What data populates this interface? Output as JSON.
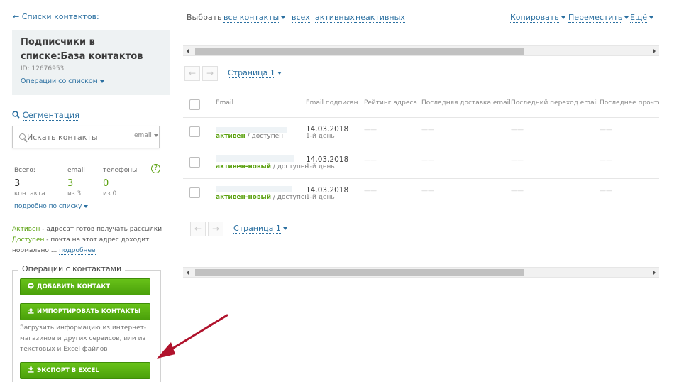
{
  "sidebar": {
    "back_link": "← Списки контактов:",
    "list_title": "Подписчики в списке:База контактов",
    "list_id": "ID: 12676953",
    "list_ops": "Операции со списком",
    "segmentation": "Сегментация",
    "search_placeholder": "Искать контакты",
    "search_type": "email",
    "stats": {
      "total_label": "Всего:",
      "email_label": "email",
      "phone_label": "телефоны",
      "total_value": "3",
      "email_value": "3",
      "phone_value": "0",
      "total_sub": "контакта",
      "email_sub": "из 3",
      "phone_sub": "из 0",
      "help": "?"
    },
    "details_link": "подробно по списку",
    "legend": {
      "active_term": "Активен",
      "active_desc": " - адресат готов получать рассылки",
      "available_term": "Доступен",
      "available_desc": " - почта на этот адрес доходит нормально ... ",
      "more_link": "подробнее"
    },
    "ops_title": "Операции с контактами",
    "add_contact": "ДОБАВИТЬ КОНТАКТ",
    "import_contacts": "ИМПОРТИРОВАТЬ КОНТАКТЫ",
    "import_desc": "Загрузить информацию из интернет-магазинов и других сервисов, или из текстовых и Excel файлов",
    "export_excel": "ЭКСПОРТ В EXCEL"
  },
  "toolbar": {
    "choose": "Выбрать",
    "all_contacts": "все контакты",
    "everyone": "всех",
    "active": "активных",
    "inactive": "неактивных",
    "copy": "Копировать",
    "move": "Переместить",
    "more": "Ещё"
  },
  "pager": {
    "page_label": "Страница 1"
  },
  "table": {
    "headers": [
      "Email",
      "Email подписан",
      "Рейтинг адреса",
      "Последняя доставка email",
      "Последний переход email",
      "Последнее прочтени"
    ],
    "rows": [
      {
        "status": "активен",
        "availability": "доступен",
        "date": "14.03.2018",
        "day": "1-й день"
      },
      {
        "status": "активен-новый",
        "availability": "доступен",
        "date": "14.03.2018",
        "day": "1-й день"
      },
      {
        "status": "активен-новый",
        "availability": "доступен",
        "date": "14.03.2018",
        "day": "1-й день"
      }
    ],
    "dash": "——",
    "separator": " / "
  },
  "colors": {
    "link": "#2a6fa0",
    "green": "#5aa10f",
    "arrow": "#b0122c"
  }
}
